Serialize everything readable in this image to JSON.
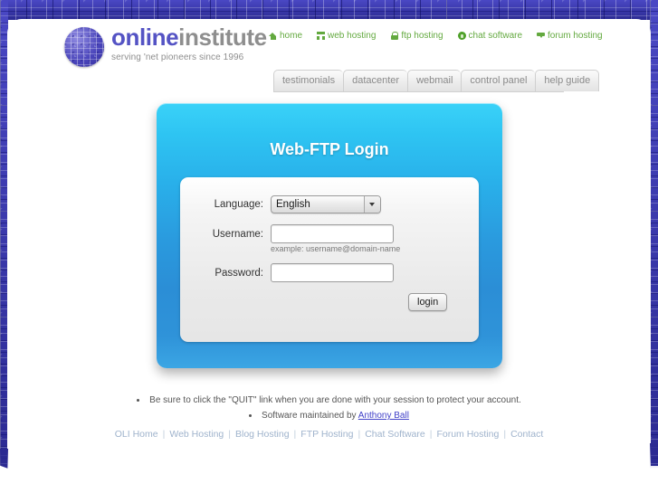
{
  "brand": {
    "logo_icon": "circuit-circle-logo",
    "word_primary": "online",
    "word_secondary": "institute",
    "tagline": "serving 'net pioneers since 1996",
    "primary_color": "#5453c4",
    "secondary_color": "#8e8e8e"
  },
  "topnav": {
    "items": [
      {
        "label": "home",
        "icon": "home-icon"
      },
      {
        "label": "web hosting",
        "icon": "server-icon"
      },
      {
        "label": "ftp hosting",
        "icon": "lock-icon"
      },
      {
        "label": "chat software",
        "icon": "chat-bubble-icon"
      },
      {
        "label": "forum hosting",
        "icon": "forum-icon"
      }
    ],
    "color": "#63a93f"
  },
  "tabs": [
    {
      "label": "testimonials"
    },
    {
      "label": "datacenter"
    },
    {
      "label": "webmail"
    },
    {
      "label": "control panel"
    },
    {
      "label": "help guide"
    }
  ],
  "login_panel": {
    "title": "Web-FTP Login",
    "accent_top": "#3ad2f8",
    "accent_bottom": "#2b8ed6",
    "fields": {
      "language_label": "Language:",
      "language_value": "English",
      "language_options": [
        "English"
      ],
      "username_label": "Username:",
      "username_value": "",
      "username_hint": "example: username@domain-name",
      "password_label": "Password:",
      "password_value": ""
    },
    "submit_label": "login"
  },
  "notes": [
    {
      "text": "Be sure to click the \"QUIT\" link when you are done with your session to protect your account."
    }
  ],
  "note_software": {
    "prefix": "Software maintained by ",
    "link_label": "Anthony Ball",
    "link_color": "#4040c8"
  },
  "footer": {
    "separator": "|",
    "links": [
      {
        "label": "OLI Home"
      },
      {
        "label": "Web Hosting"
      },
      {
        "label": "Blog Hosting"
      },
      {
        "label": "FTP Hosting"
      },
      {
        "label": "Chat Software"
      },
      {
        "label": "Forum Hosting"
      },
      {
        "label": "Contact"
      }
    ],
    "color": "#9fb3cc"
  }
}
